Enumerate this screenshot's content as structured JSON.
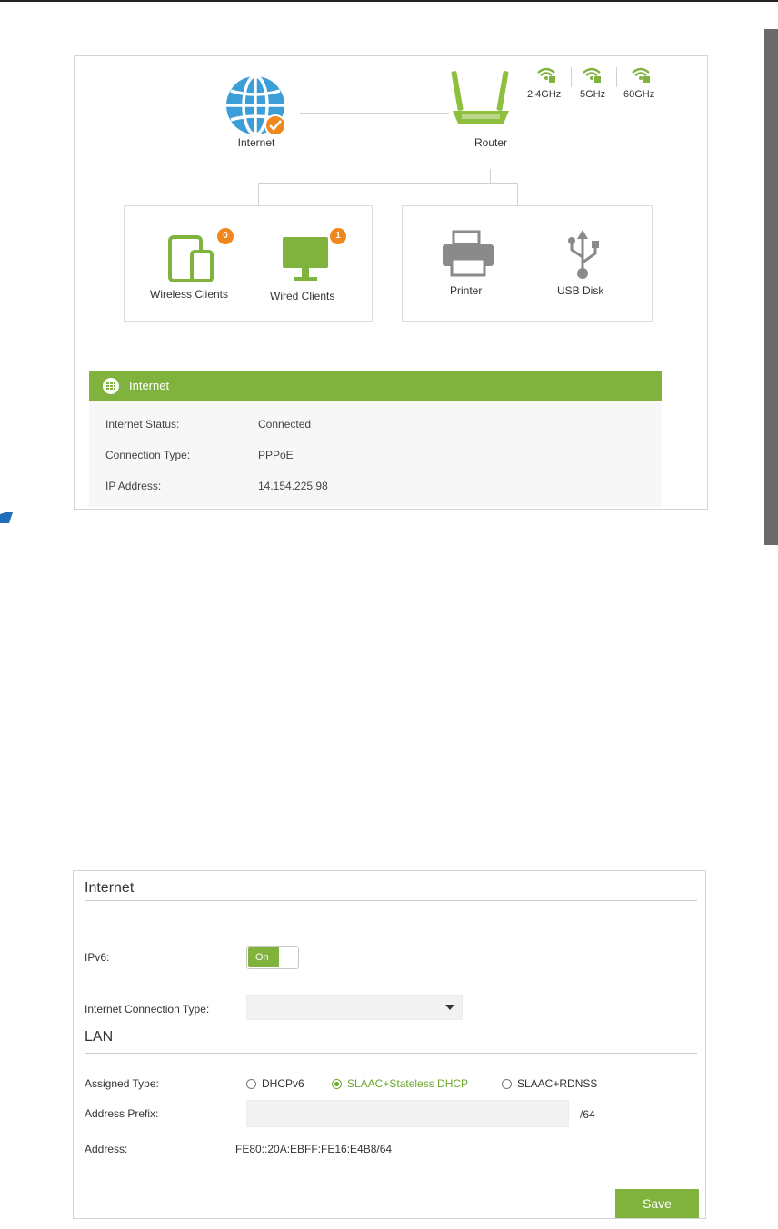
{
  "network_map": {
    "internet_label": "Internet",
    "router_label": "Router",
    "bands": [
      "2.4GHz",
      "5GHz",
      "60GHz"
    ],
    "clients": {
      "wireless_label": "Wireless Clients",
      "wireless_count": "0",
      "wired_label": "Wired Clients",
      "wired_count": "1"
    },
    "usb": {
      "printer_label": "Printer",
      "disk_label": "USB Disk"
    }
  },
  "internet_info": {
    "title": "Internet",
    "rows": [
      {
        "label": "Internet Status:",
        "value": "Connected"
      },
      {
        "label": "Connection Type:",
        "value": "PPPoE"
      },
      {
        "label": "IP Address:",
        "value": "14.154.225.98"
      }
    ]
  },
  "ipv6_form": {
    "internet_title": "Internet",
    "ipv6_label": "IPv6:",
    "toggle_text": "On",
    "connection_type_label": "Internet Connection Type:",
    "connection_type_value": "",
    "lan_title": "LAN",
    "assigned_type_label": "Assigned Type:",
    "assigned_options": [
      "DHCPv6",
      "SLAAC+Stateless DHCP",
      "SLAAC+RDNSS"
    ],
    "assigned_selected": "SLAAC+Stateless DHCP",
    "prefix_label": "Address Prefix:",
    "prefix_value": "",
    "prefix_suffix": "/64",
    "address_label": "Address:",
    "address_value": "FE80::20A:EBFF:FE16:E4B8/64",
    "save_label": "Save"
  },
  "colors": {
    "accent_green": "#7fb33e",
    "globe_blue": "#3b9ed8",
    "badge_orange": "#f0871c",
    "icon_gray": "#8a8a8a"
  }
}
